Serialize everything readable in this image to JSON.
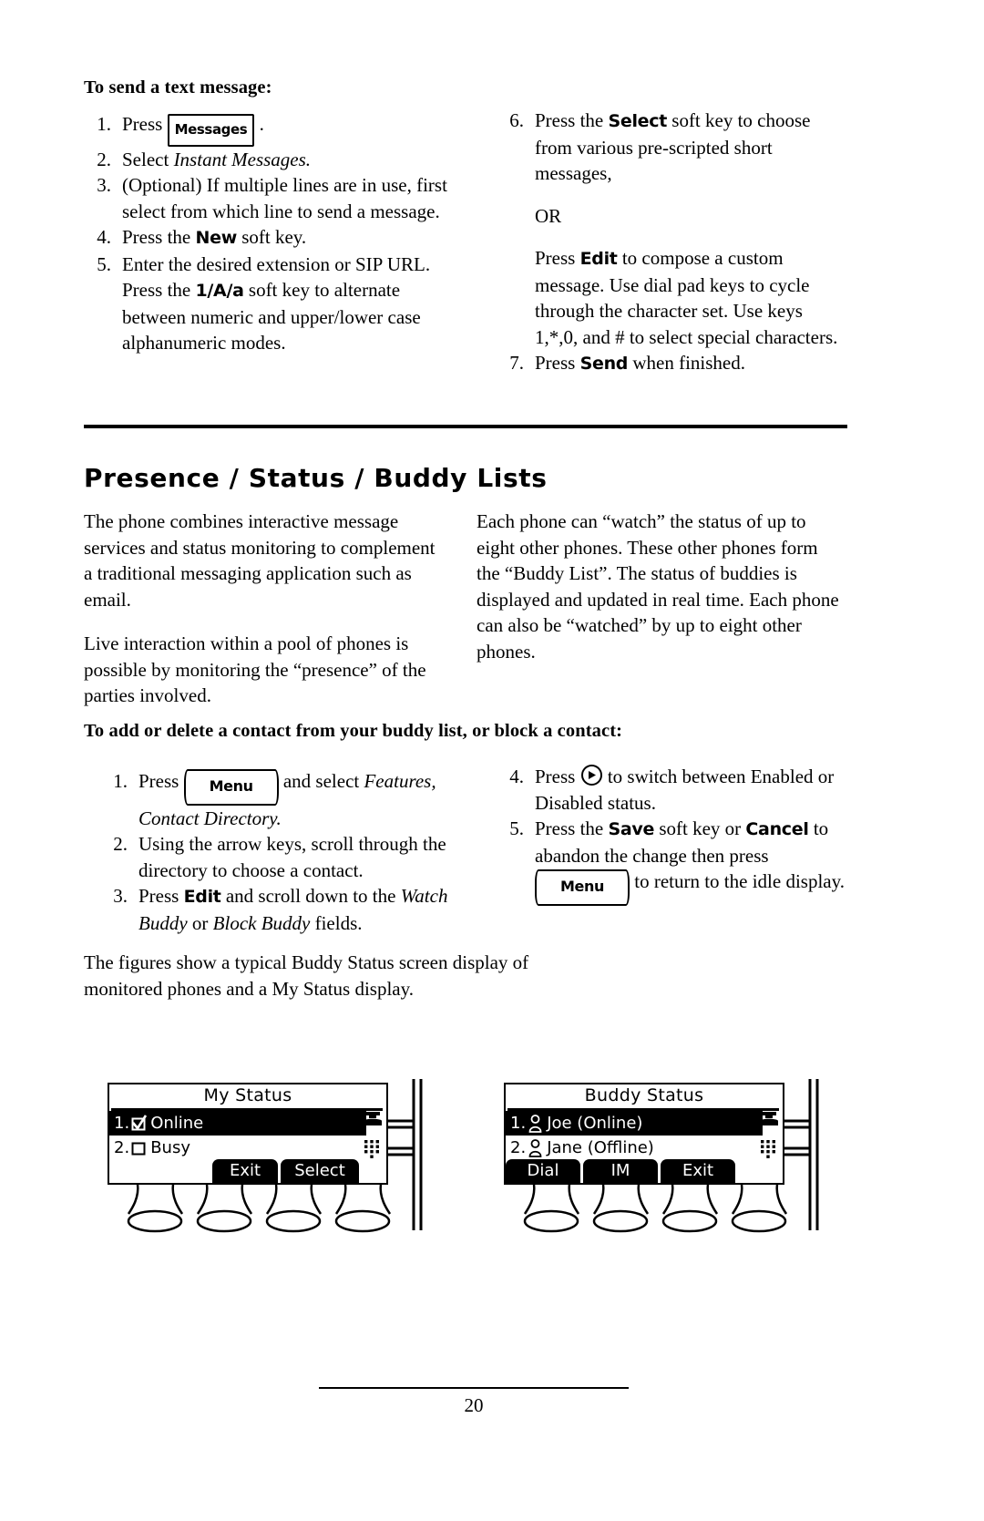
{
  "section_1": {
    "heading": "To send a text message:",
    "left_steps": [
      {
        "num": "1.",
        "pre": "Press ",
        "key": "Messages",
        "post": " ."
      },
      {
        "num": "2.",
        "pre": "Select ",
        "em": "Instant Messages.",
        "post": ""
      },
      {
        "num": "3.",
        "text": "(Optional)  If multiple lines are in use, first select from which line to send a message."
      },
      {
        "num": "4.",
        "pre": "Press the ",
        "sf": "New",
        "post": " soft key."
      },
      {
        "num": "5.",
        "pre": "Enter the desired extension or SIP URL.  Press the ",
        "sf": "1/A/a",
        "post": " soft key to alternate between numeric and upper/lower case alphanumeric modes."
      }
    ],
    "right_steps": [
      {
        "num": "6.",
        "pre": "Press the ",
        "sf": "Select",
        "post": " soft key to choose from various pre-scripted short messages,"
      },
      {
        "or": "OR"
      },
      {
        "pre": "Press ",
        "sf": "Edit",
        "post": " to compose a custom message.  Use dial pad keys to cycle through the character set.  Use keys 1,*,0, and # to select special characters."
      },
      {
        "num": "7.",
        "pre": "Press ",
        "sf": "Send",
        "post": " when finished."
      }
    ]
  },
  "section_2": {
    "heading": "Presence / Status / Buddy Lists",
    "left_paras": [
      "The phone combines interactive message services and status monitoring to complement a traditional messaging application such as email.",
      "Live interaction within a pool of phones is possible by monitoring the “presence” of the parties involved."
    ],
    "right_paras": [
      "Each phone can “watch” the status of up to eight other phones.  These other phones form the “Buddy List”.  The status of buddies is displayed and updated in real time.  Each phone can also be “watched” by up to eight other phones."
    ],
    "sub_heading": "To add or delete a contact from your buddy list, or block a contact:",
    "left_steps": [
      {
        "num": "1.",
        "pre": "Press ",
        "key": "Menu",
        "mid": " and select ",
        "em": "Features, Contact Directory.",
        "post": ""
      },
      {
        "num": "2.",
        "text": "Using the arrow keys, scroll through the directory to choose a contact."
      },
      {
        "num": "3.",
        "pre": "Press ",
        "sf": "Edit",
        "mid": " and scroll down to the ",
        "em": "Watch Buddy",
        "mid2": " or ",
        "em2": "Block Buddy",
        "post": " fields."
      }
    ],
    "right_steps": [
      {
        "num": "4.",
        "pre": "Press ",
        "icon": "circle-right-arrow-key",
        "post": " to switch between Enabled or Disabled status."
      },
      {
        "num": "5.",
        "pre": "Press the ",
        "sf": "Save",
        "mid": " soft key or ",
        "sf2": "Cancel",
        "mid2": " to abandon the change then press ",
        "key": "Menu",
        "post": " to return to the idle display."
      }
    ],
    "closing_para": "The figures show a typical Buddy Status screen display of monitored phones and a My Status display."
  },
  "figure_left": {
    "title": "My Status",
    "rows": [
      {
        "idx": "1.",
        "icon": "checked-box-icon",
        "label": "Online",
        "selected": true
      },
      {
        "idx": "2.",
        "icon": "empty-box-icon",
        "label": "Busy",
        "selected": false
      }
    ],
    "softkeys": [
      "Exit",
      "Select"
    ],
    "status_icons": [
      "handset-icon",
      "dialpad-icon"
    ]
  },
  "figure_right": {
    "title": "Buddy Status",
    "rows": [
      {
        "idx": "1.",
        "icon": "person-icon",
        "label": "Joe (Online)",
        "selected": true
      },
      {
        "idx": "2.",
        "icon": "person-icon",
        "label": "Jane (Offline)",
        "selected": false
      }
    ],
    "softkeys": [
      "Dial",
      "IM",
      "Exit"
    ],
    "status_icons": [
      "handset-icon",
      "dialpad-icon"
    ]
  },
  "footer": {
    "page_number": "20"
  }
}
